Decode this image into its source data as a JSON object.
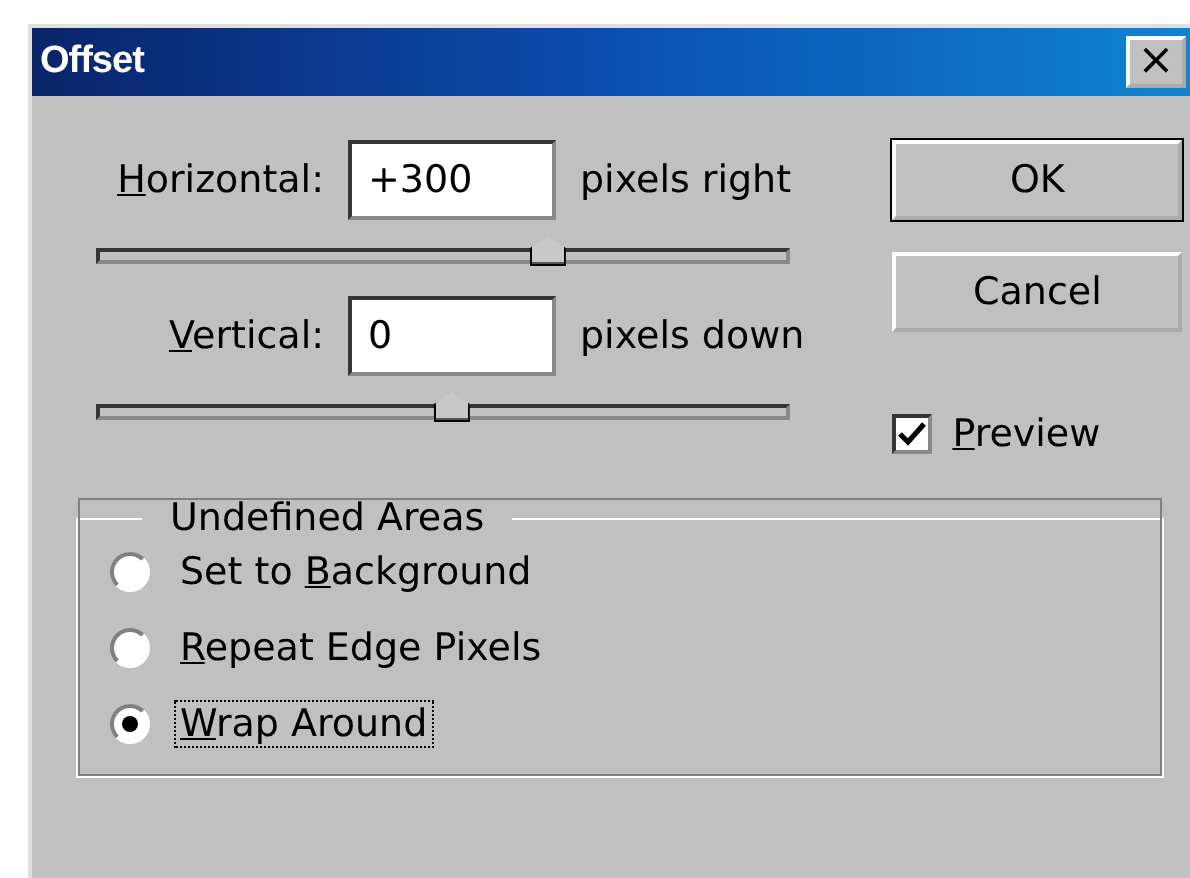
{
  "window": {
    "title": "Offset",
    "close_symbol": "×"
  },
  "offsets": [
    {
      "access_key": "H",
      "label_rest": "orizontal:",
      "value": "+300",
      "unit": "pixels right",
      "level": 0.65
    },
    {
      "access_key": "V",
      "label_rest": "ertical:",
      "value": "0",
      "unit": "pixels down",
      "level": 0.51
    }
  ],
  "buttons": [
    {
      "label": "OK",
      "default": true
    },
    {
      "label": "Cancel",
      "default": false
    }
  ],
  "preview": {
    "access_key": "P",
    "label_rest": "review",
    "checked": true
  },
  "undefined_areas": {
    "title": "Undefined Areas",
    "options": [
      {
        "label_prefix": "Set to ",
        "access_key": "B",
        "label_rest": "ackground",
        "selected": false
      },
      {
        "access_key": "R",
        "label_rest": "epeat Edge Pixels",
        "selected": false
      },
      {
        "access_key": "W",
        "label_rest": "rap Around",
        "selected": true
      }
    ]
  }
}
